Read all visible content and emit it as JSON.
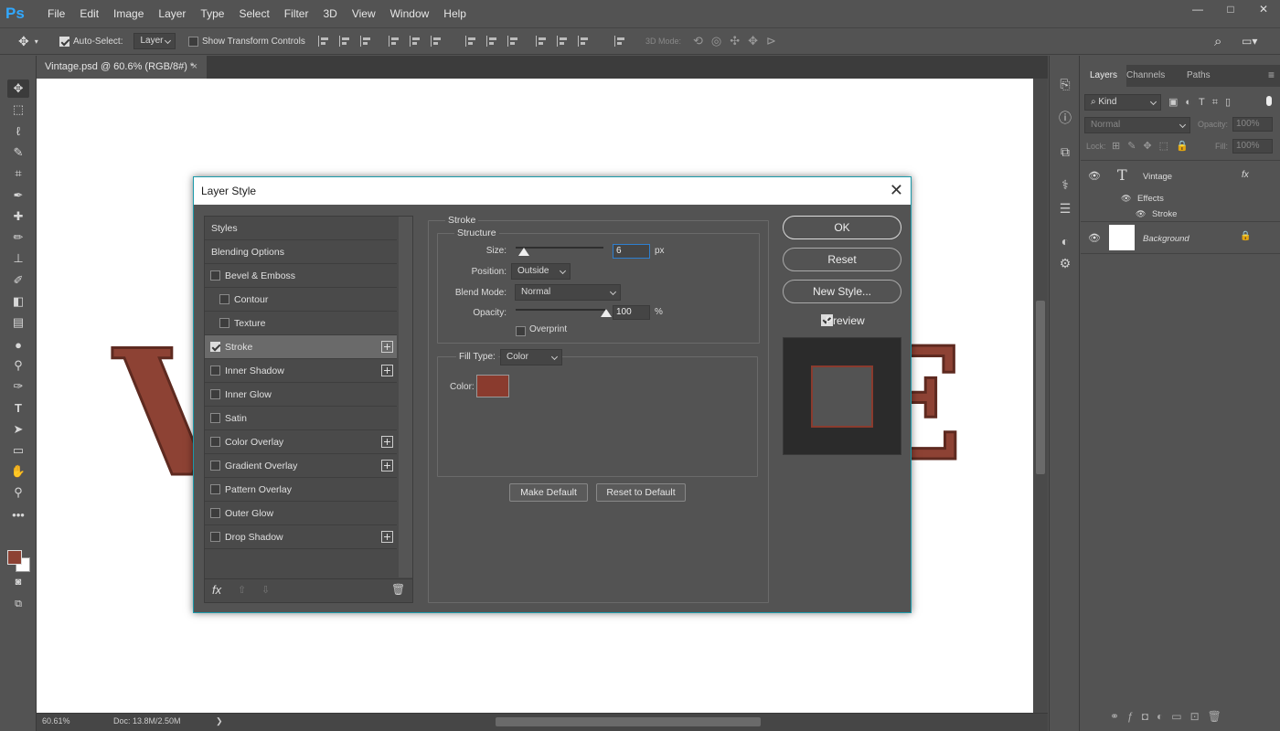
{
  "app": {
    "logo": "Ps",
    "menu": [
      "File",
      "Edit",
      "Image",
      "Layer",
      "Type",
      "Select",
      "Filter",
      "3D",
      "View",
      "Window",
      "Help"
    ],
    "window_controls": [
      "—",
      "□",
      "✕"
    ]
  },
  "options": {
    "auto_select_label": "Auto-Select:",
    "auto_select_value": "Layer",
    "transform_label": "Show Transform Controls",
    "mode_3d": "3D Mode:"
  },
  "document": {
    "tab_title": "Vintage.psd @ 60.6% (RGB/8#) *",
    "close": "×",
    "letters": [
      "V",
      "E"
    ]
  },
  "status": {
    "zoom": "60.61%",
    "doc": "Doc: 13.8M/2.50M",
    "arrow": "❯"
  },
  "layers_panel": {
    "tabs": [
      "Layers",
      "Channels",
      "Paths"
    ],
    "filter": "Kind",
    "blend": "Normal",
    "opacity_label": "Opacity:",
    "opacity": "100%",
    "lock_label": "Lock:",
    "fill_label": "Fill:",
    "fill": "100%",
    "layers": [
      {
        "name": "Vintage",
        "effects_label": "Effects",
        "effect": "Stroke",
        "fx": "fx"
      },
      {
        "name": "Background"
      }
    ]
  },
  "dialog": {
    "title": "Layer Style",
    "styles_list": [
      {
        "label": "Styles",
        "checkbox": false,
        "checked": false,
        "indent": false,
        "plus": false,
        "selected": false
      },
      {
        "label": "Blending Options",
        "checkbox": false,
        "checked": false,
        "indent": false,
        "plus": false,
        "selected": false
      },
      {
        "label": "Bevel & Emboss",
        "checkbox": true,
        "checked": false,
        "indent": false,
        "plus": false,
        "selected": false
      },
      {
        "label": "Contour",
        "checkbox": true,
        "checked": false,
        "indent": true,
        "plus": false,
        "selected": false
      },
      {
        "label": "Texture",
        "checkbox": true,
        "checked": false,
        "indent": true,
        "plus": false,
        "selected": false
      },
      {
        "label": "Stroke",
        "checkbox": true,
        "checked": true,
        "indent": false,
        "plus": true,
        "selected": true
      },
      {
        "label": "Inner Shadow",
        "checkbox": true,
        "checked": false,
        "indent": false,
        "plus": true,
        "selected": false
      },
      {
        "label": "Inner Glow",
        "checkbox": true,
        "checked": false,
        "indent": false,
        "plus": false,
        "selected": false
      },
      {
        "label": "Satin",
        "checkbox": true,
        "checked": false,
        "indent": false,
        "plus": false,
        "selected": false
      },
      {
        "label": "Color Overlay",
        "checkbox": true,
        "checked": false,
        "indent": false,
        "plus": true,
        "selected": false
      },
      {
        "label": "Gradient Overlay",
        "checkbox": true,
        "checked": false,
        "indent": false,
        "plus": true,
        "selected": false
      },
      {
        "label": "Pattern Overlay",
        "checkbox": true,
        "checked": false,
        "indent": false,
        "plus": false,
        "selected": false
      },
      {
        "label": "Outer Glow",
        "checkbox": true,
        "checked": false,
        "indent": false,
        "plus": false,
        "selected": false
      },
      {
        "label": "Drop Shadow",
        "checkbox": true,
        "checked": false,
        "indent": false,
        "plus": true,
        "selected": false
      }
    ],
    "footer_fx": "fx",
    "stroke": {
      "section": "Stroke",
      "structure": "Structure",
      "size_label": "Size:",
      "size_value": "6",
      "size_unit": "px",
      "size_fraction": 0.03,
      "position_label": "Position:",
      "position_value": "Outside",
      "blend_label": "Blend Mode:",
      "blend_value": "Normal",
      "opacity_label": "Opacity:",
      "opacity_value": "100",
      "opacity_unit": "%",
      "opacity_fraction": 1.0,
      "overprint_label": "Overprint",
      "fill_type_label": "Fill Type:",
      "fill_type_value": "Color",
      "color_label": "Color:",
      "color_hex": "#8a3b2e"
    },
    "make_default": "Make Default",
    "reset_default": "Reset to Default",
    "buttons": {
      "ok": "OK",
      "reset": "Reset",
      "new_style": "New Style...",
      "preview": "Preview"
    }
  },
  "colors": {
    "foreground": "#8d4234",
    "background": "#ffffff",
    "accent": "#1b9aaa"
  }
}
